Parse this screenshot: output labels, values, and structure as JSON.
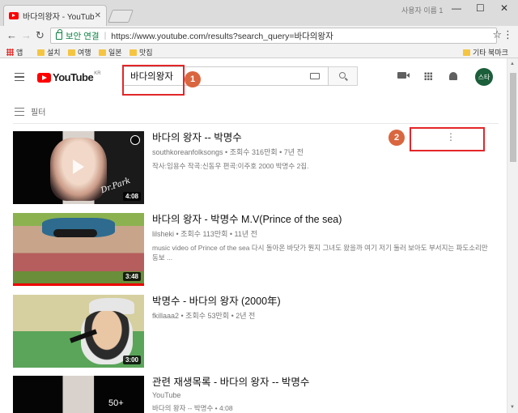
{
  "browser": {
    "tab_title": "바다의왕자 - YouTube",
    "tab_close": "✕",
    "profile_name": "사용자 이름 1",
    "secure_label": "보안 연결",
    "url": "https://www.youtube.com/results?search_query=바다의왕자",
    "bookmarks": [
      "앱",
      "설치",
      "여행",
      "일본",
      "맛집"
    ],
    "other_bookmarks": "기타 북마크"
  },
  "youtube": {
    "logo_text": "YouTube",
    "logo_region": "KR",
    "search_query": "바다의왕자",
    "avatar_label": "스타",
    "filter_label": "필터"
  },
  "annotations": {
    "marker1": "1",
    "marker2": "2",
    "color": "#e3262a",
    "marker_color": "#d9663f"
  },
  "results": [
    {
      "title": "바다의 왕자 -- 박명수",
      "meta": "southkoreanfolksongs • 조회수 316만회 • 7년 전",
      "desc": "작사:임용수 작곡:신동우 편곡:이주호 2000 박명수 2집.",
      "duration": "4:08",
      "overlay": "Dr.Park"
    },
    {
      "title": "바다의 왕자 - 박명수 M.V(Prince of the sea)",
      "meta": "lilsheki • 조회수 113만회 • 11년 전",
      "desc": "music video of Prince of the sea 다시 돌아온 바닷가 뭔지 그녀도 왔을까 여기 저기 둘러 보아도 부서지는 파도소리만 동보 ...",
      "duration": "3:48"
    },
    {
      "title": "박명수 - 바다의 왕자 (2000年)",
      "meta": "fkillaaa2 • 조회수 53만회 • 2년 전",
      "desc": "",
      "duration": "3:00"
    },
    {
      "title": "관련 재생목록 - 바다의 왕자 -- 박명수",
      "meta": "YouTube",
      "desc": "바다의 왕자 -- 박명수 • 4:08",
      "duration": "50+"
    }
  ],
  "more_icon": "⋮"
}
